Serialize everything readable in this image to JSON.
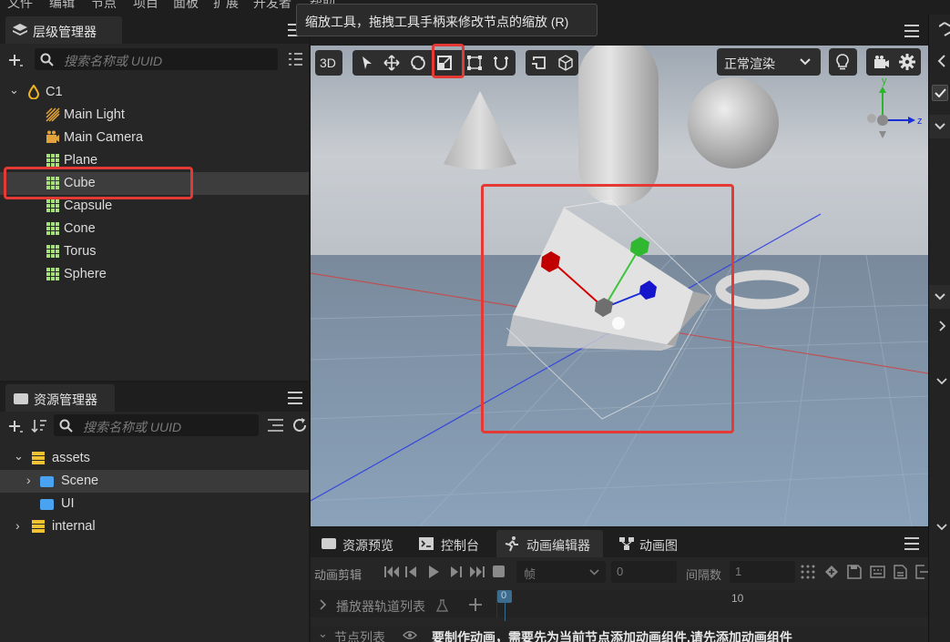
{
  "menu": [
    "文件",
    "编辑",
    "节点",
    "项目",
    "面板",
    "扩展",
    "开发者",
    "帮助"
  ],
  "tooltip": "缩放工具，拖拽工具手柄来修改节点的缩放 (R)",
  "hierarchy": {
    "title": "层级管理器",
    "search_placeholder": "搜索名称或 UUID",
    "root": "C1",
    "items": [
      {
        "label": "Main Light",
        "icon": "light-icon"
      },
      {
        "label": "Main Camera",
        "icon": "camera-icon"
      },
      {
        "label": "Plane",
        "icon": "mesh-icon"
      },
      {
        "label": "Cube",
        "icon": "mesh-icon",
        "selected": true
      },
      {
        "label": "Capsule",
        "icon": "mesh-icon"
      },
      {
        "label": "Cone",
        "icon": "mesh-icon"
      },
      {
        "label": "Torus",
        "icon": "mesh-icon"
      },
      {
        "label": "Sphere",
        "icon": "mesh-icon"
      }
    ]
  },
  "assets": {
    "title": "资源管理器",
    "search_placeholder": "搜索名称或 UUID",
    "items": [
      {
        "label": "assets",
        "type": "db",
        "expanded": true
      },
      {
        "label": "Scene",
        "type": "folder",
        "expanded": false
      },
      {
        "label": "UI",
        "type": "folder"
      },
      {
        "label": "internal",
        "type": "db",
        "expanded": false
      }
    ]
  },
  "scene": {
    "mode_3d": "3D",
    "render_mode": "正常渲染",
    "axis_labels": {
      "y": "y",
      "z": "z"
    }
  },
  "bottom": {
    "tabs": [
      "资源预览",
      "控制台",
      "动画编辑器",
      "动画图"
    ],
    "active_tab": 2,
    "clip_label": "动画剪辑",
    "unit_label": "帧",
    "frame_value": "0",
    "interval_label": "间隔数",
    "interval_value": "1",
    "tracks_label": "播放器轨道列表",
    "timeline_marks": [
      "0",
      "10"
    ],
    "node_list_label": "节点列表",
    "warning": "要制作动画，需要先为当前节点添加动画组件,请先添加动画组件"
  },
  "colors": {
    "accent_red": "#e53935",
    "gizmo_red": "#d40000",
    "gizmo_green": "#3ac53a",
    "gizmo_blue": "#1a2ed8"
  }
}
